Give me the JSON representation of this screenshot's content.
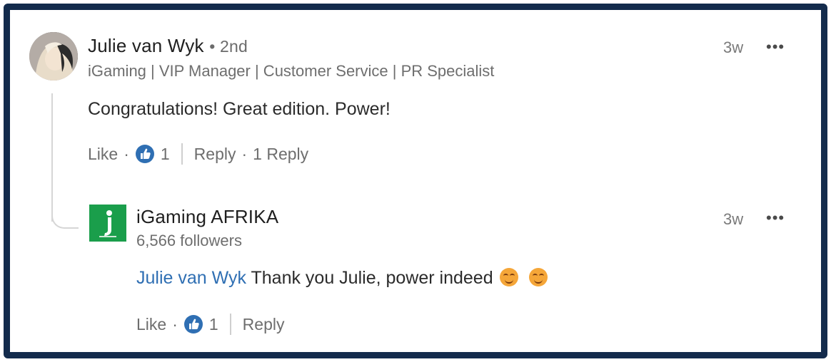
{
  "comment": {
    "author": "Julie van Wyk",
    "degree": "• 2nd",
    "headline": "iGaming | VIP Manager | Customer Service | PR Specialist",
    "time": "3w",
    "more": "•••",
    "text": "Congratulations! Great edition. Power!",
    "like_label": "Like",
    "dot1": "·",
    "like_count": "1",
    "reply_label": "Reply",
    "dot2": "·",
    "reply_count": "1 Reply"
  },
  "reply": {
    "author": "iGaming AFRIKA",
    "followers": "6,566 followers",
    "time": "3w",
    "more": "•••",
    "mention": "Julie van Wyk",
    "text": " Thank you Julie, power indeed",
    "like_label": "Like",
    "dot1": "·",
    "like_count": "1",
    "reply_label": "Reply"
  },
  "colors": {
    "frame": "#132b4c",
    "like_icon": "#2f6fb3",
    "mention": "#2f6fb3",
    "logo": "#1a9e4b"
  },
  "icons": {
    "like_reaction": "thumbs-up-icon",
    "emoji": "smiling-face-icon",
    "logo": "igaming-afrika-logo"
  }
}
